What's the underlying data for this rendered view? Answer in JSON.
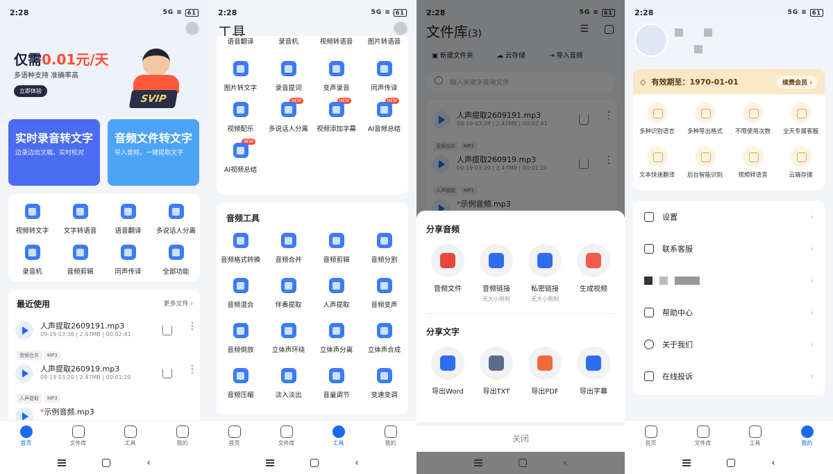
{
  "status": {
    "time": "2:28",
    "battery": "61",
    "signal": "5G"
  },
  "tabbar": [
    {
      "label": "首页"
    },
    {
      "label": "文件库"
    },
    {
      "label": "工具"
    },
    {
      "label": "我的"
    }
  ],
  "home": {
    "promo": {
      "prefix": "仅需",
      "price": "0.01元/天",
      "sub": "多语种支持 准确率高",
      "btn": "立即体验",
      "badge": "SVIP"
    },
    "big_cards": [
      {
        "title": "实时录音转文字",
        "sub": "边录边出文稿，实时校对",
        "color": "#4a6cf0"
      },
      {
        "title": "音频文件转文字",
        "sub": "导入音频，一键提取文字",
        "color": "#4da3f5"
      }
    ],
    "tools": [
      "视频转文字",
      "文字转语音",
      "语音翻译",
      "多说话人分离",
      "录音机",
      "音频剪辑",
      "同声传译",
      "全部功能"
    ],
    "recent": {
      "title": "最近使用",
      "more": "更多文件",
      "files": [
        {
          "name": "人声提取2609191.mp3",
          "meta": "09-19 03:38 | 2.47MB | 00:02:41",
          "tags": [
            "音频合并",
            "MP3"
          ]
        },
        {
          "name": "人声提取260919.mp3",
          "meta": "09-19 03:20 | 2.47MB | 00:01:20",
          "tags": [
            "人声提取",
            "MP3"
          ]
        },
        {
          "name": "示例音频.mp3",
          "meta": "",
          "tags": []
        }
      ]
    }
  },
  "tools_page": {
    "title": "工具",
    "top_partial": [
      "语音翻译",
      "录音机",
      "视频转语音",
      "图片转语音"
    ],
    "row2": [
      "图片转文字",
      "录音提词",
      "变声录音",
      "同声传译"
    ],
    "row3": [
      {
        "label": "视频配乐",
        "new": false
      },
      {
        "label": "多说话人分离",
        "new": true
      },
      {
        "label": "视频添加字幕",
        "new": true
      },
      {
        "label": "AI音频总结",
        "new": true
      }
    ],
    "row4": [
      {
        "label": "AI视频总结",
        "new": true
      }
    ],
    "new_tag": "NEW",
    "audio_title": "音频工具",
    "audio_tools": [
      "音频格式转换",
      "音频合并",
      "音频剪辑",
      "音频分割",
      "音频混合",
      "伴奏提取",
      "人声提取",
      "音频变声",
      "音频倒放",
      "立体声环绕",
      "立体声分离",
      "立体声合成",
      "音频压缩",
      "淡入淡出",
      "音量调节",
      "变速变调"
    ]
  },
  "library": {
    "title": "文件库",
    "count": "(3)",
    "actions": [
      "新建文件夹",
      "云存储",
      "导入音频"
    ],
    "search_placeholder": "输入关键字查询文件",
    "files": [
      {
        "name": "人声提取2609191.mp3",
        "meta": "09-19 03:38 | 2.47MB | 00:02:41",
        "tags": [
          "音频合并",
          "MP3"
        ]
      },
      {
        "name": "人声提取260919.mp3",
        "meta": "09-19 03:20 | 2.47MB | 00:01:20",
        "tags": [
          "人声提取",
          "MP3"
        ]
      },
      {
        "name": "示例音频.mp3",
        "meta": "",
        "tags": []
      }
    ],
    "sheet": {
      "audio_title": "分享音频",
      "audio_items": [
        {
          "label": "音频文件",
          "sub": "",
          "color": "#e8473b"
        },
        {
          "label": "音频链接",
          "sub": "无大小限制",
          "color": "#2f6df0"
        },
        {
          "label": "私密链接",
          "sub": "无大小限制",
          "color": "#2f6df0"
        },
        {
          "label": "生成视频",
          "sub": "",
          "color": "#f25b4b"
        }
      ],
      "text_title": "分享文字",
      "text_items": [
        {
          "label": "导出Word",
          "color": "#2f6df0"
        },
        {
          "label": "导出TXT",
          "color": "#5c6b8a"
        },
        {
          "label": "导出PDF",
          "color": "#f06a3a"
        },
        {
          "label": "导出字幕",
          "color": "#2f6df0"
        }
      ],
      "close": "关闭"
    }
  },
  "mine": {
    "vip_expiry": "有效期至：1970-01-01",
    "renew": "续费会员",
    "perks": [
      "多种识别语言",
      "多种导出格式",
      "不限使用次数",
      "全天专属客服",
      "文本快速翻译",
      "后台智能识别",
      "视频转语音",
      "云端存储"
    ],
    "menu": [
      "设置",
      "联系客服",
      "",
      "帮助中心",
      "关于我们",
      "在线投诉"
    ]
  }
}
